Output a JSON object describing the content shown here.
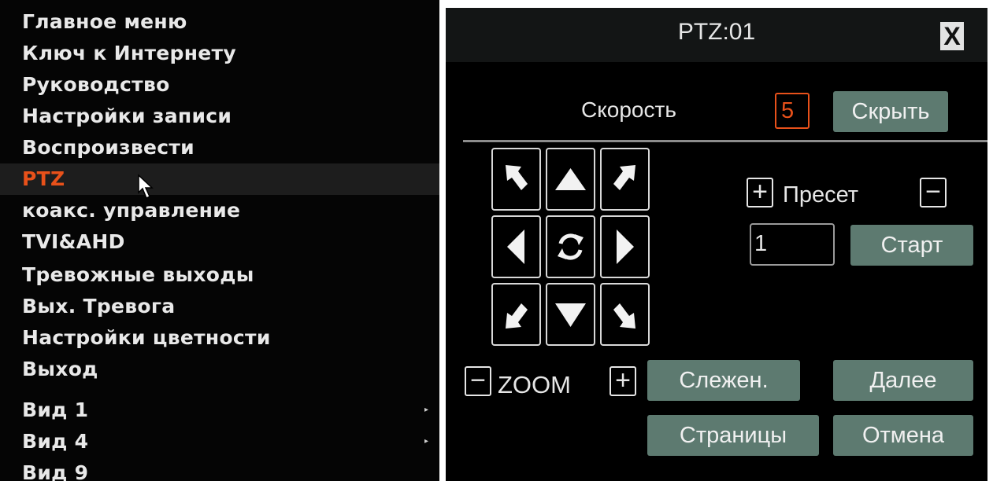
{
  "menu": {
    "items": [
      {
        "label": "Главное меню"
      },
      {
        "label": "Ключ к Интернету"
      },
      {
        "label": "Руководство"
      },
      {
        "label": "Настройки записи"
      },
      {
        "label": "Воспроизвести"
      },
      {
        "label": "PTZ",
        "active": true
      },
      {
        "label": "коакс. управление"
      },
      {
        "label": "TVI&AHD"
      },
      {
        "label": "Тревожные выходы"
      },
      {
        "label": "Вых. Тревога"
      },
      {
        "label": "Настройки цветности"
      },
      {
        "label": "Выход"
      },
      {
        "label": "Вид 1",
        "submenu": true
      },
      {
        "label": "Вид 4",
        "submenu": true
      },
      {
        "label": "Вид 9"
      }
    ],
    "submenu_arrow": "▸",
    "active_color": "#e8511a"
  },
  "ptz": {
    "title": "PTZ:01",
    "close_label": "X",
    "speed_label": "Скорость",
    "speed_value": "5",
    "hide_label": "Скрыть",
    "preset_label": "Пресет",
    "preset_plus": "+",
    "preset_minus": "−",
    "preset_value": "1",
    "start_label": "Старт",
    "zoom_label": "ZOOM",
    "zoom_minus": "−",
    "zoom_plus": "+",
    "track_label": "Слежен.",
    "next_label": "Далее",
    "pages_label": "Страницы",
    "cancel_label": "Отмена",
    "button_color": "#5d7a70",
    "direction_icons": [
      "up-left-arrow-icon",
      "up-arrow-icon",
      "up-right-arrow-icon",
      "left-arrow-icon",
      "auto-rotate-icon",
      "right-arrow-icon",
      "down-left-arrow-icon",
      "down-arrow-icon",
      "down-right-arrow-icon"
    ]
  }
}
